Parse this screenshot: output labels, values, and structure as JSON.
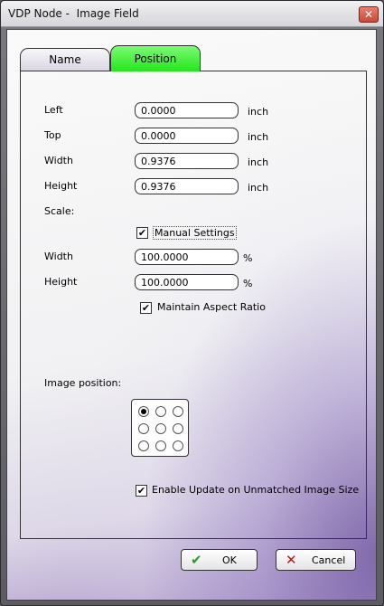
{
  "window": {
    "title": "VDP Node -  Image Field",
    "close_glyph": "✕"
  },
  "tabs": [
    {
      "label": "Name",
      "active": false
    },
    {
      "label": "Position",
      "active": true
    }
  ],
  "position": {
    "left": {
      "label": "Left",
      "value": "0.0000",
      "unit": "inch"
    },
    "top": {
      "label": "Top",
      "value": "0.0000",
      "unit": "inch"
    },
    "width": {
      "label": "Width",
      "value": "0.9376",
      "unit": "inch"
    },
    "height": {
      "label": "Height",
      "value": "0.9376",
      "unit": "inch"
    }
  },
  "scale": {
    "label": "Scale:",
    "manual_settings": {
      "label": "Manual Settings",
      "checked": true
    },
    "width": {
      "label": "Width",
      "value": "100.0000",
      "unit": "%"
    },
    "height": {
      "label": "Height",
      "value": "100.0000",
      "unit": "%"
    },
    "maintain_aspect": {
      "label": "Maintain Aspect Ratio",
      "checked": true
    }
  },
  "image_position": {
    "label": "Image position:",
    "selected": "top-left"
  },
  "enable_update": {
    "label": "Enable Update on Unmatched Image Size",
    "checked": true
  },
  "buttons": {
    "ok": {
      "label": "OK",
      "icon": "check-icon",
      "color": "#2a9a2a"
    },
    "cancel": {
      "label": "Cancel",
      "icon": "x-icon",
      "color": "#d01010"
    }
  },
  "colors": {
    "active_tab": "#3cf034",
    "accent_purple": "#8a74b8"
  }
}
